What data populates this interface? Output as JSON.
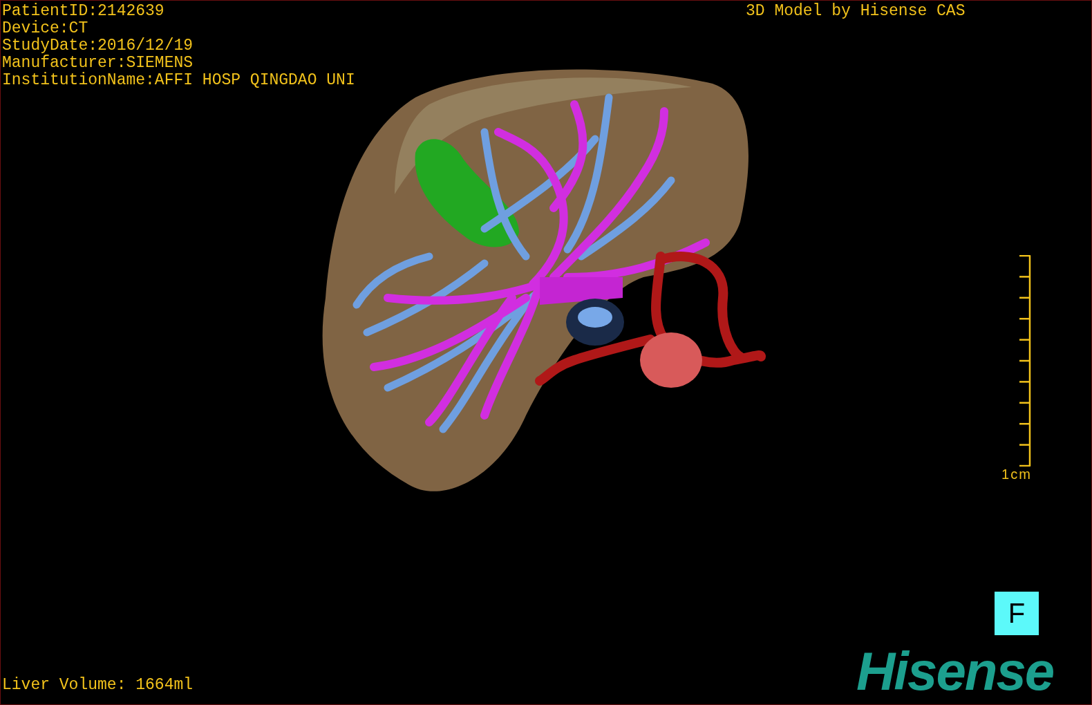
{
  "info_lines": [
    "PatientID:2142639",
    "Device:CT",
    "StudyDate:2016/12/19",
    "Manufacturer:SIEMENS",
    "InstitutionName:AFFI HOSP QINGDAO UNI"
  ],
  "credit": "3D Model by Hisense CAS",
  "scale_bar": {
    "label": "1cm"
  },
  "orientation_marker": "F",
  "liver_volume": "Liver Volume: 1664ml",
  "logo": "Hisense"
}
